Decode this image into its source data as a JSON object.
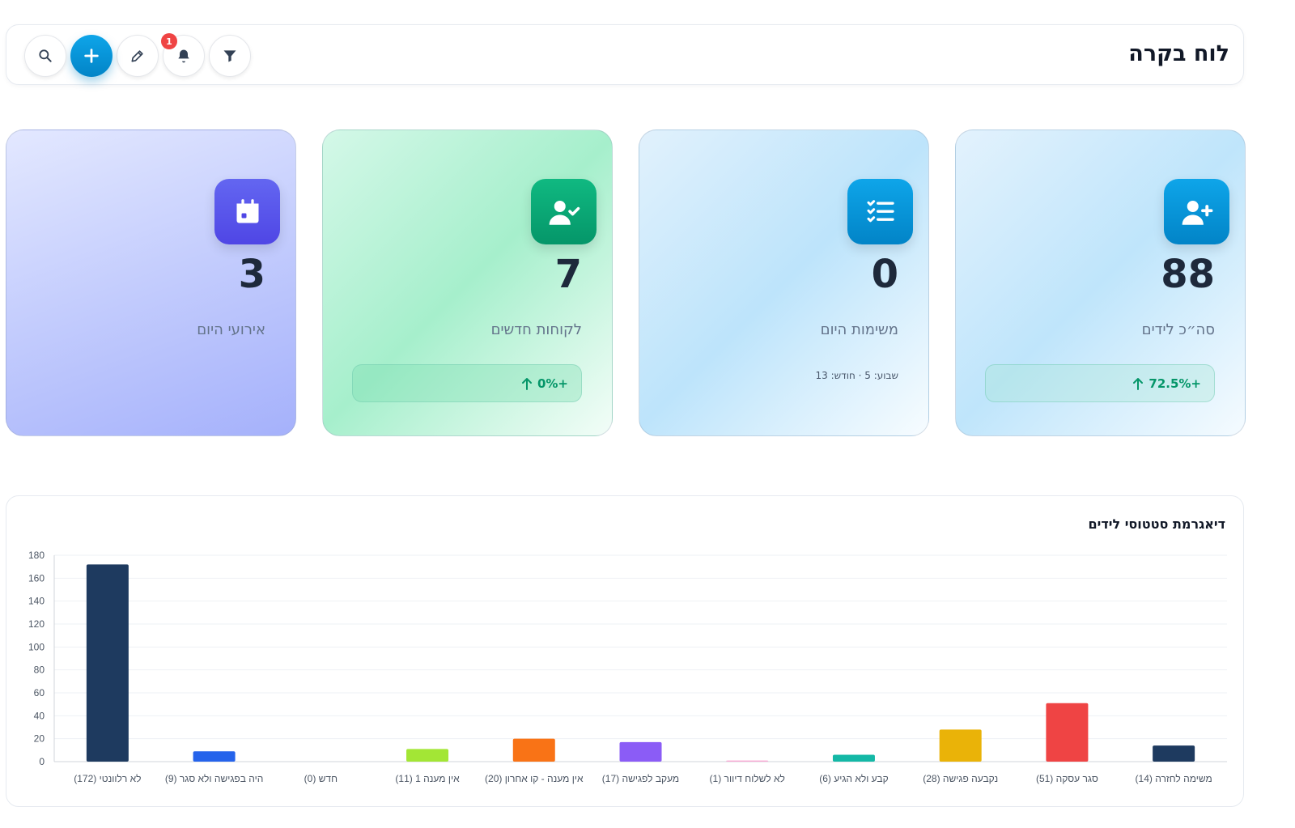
{
  "header": {
    "title": "לוח בקרה",
    "notification_count": "1",
    "buttons": [
      "filter-icon",
      "bell-icon",
      "pencil-icon",
      "plus-icon",
      "search-icon"
    ]
  },
  "cards": {
    "leads": {
      "value": "88",
      "label": "סה״כ לידים",
      "trend": "72.5%+",
      "icon": "user-plus-icon"
    },
    "tasks": {
      "value": "0",
      "label": "משימות היום",
      "sub": "שבוע: 5 · חודש: 13",
      "icon": "checklist-icon"
    },
    "customers": {
      "value": "7",
      "label": "לקוחות חדשים",
      "trend": "0%+",
      "icon": "user-check-icon"
    },
    "events": {
      "value": "3",
      "label": "אירועי היום",
      "icon": "calendar-icon"
    }
  },
  "colors": {
    "primary": "#0ea5e9",
    "success": "#059669",
    "indigo": "#4f46e5",
    "danger": "#ef4444"
  },
  "chart_data": {
    "type": "bar",
    "title": "דיאגרמת סטטוסי לידים",
    "ylim": [
      0,
      180
    ],
    "yticks": [
      0,
      20,
      40,
      60,
      80,
      100,
      120,
      140,
      160,
      180
    ],
    "categories": [
      "לא רלוונטי (172)",
      "היה בפגישה ולא סגר (9)",
      "חדש (0)",
      "אין מענה 1 (11)",
      "אין מענה - קו אחרון (20)",
      "מעקב לפגישה (17)",
      "לא לשלוח דיוור (1)",
      "קבע ולא הגיע (6)",
      "נקבעה פגישה (28)",
      "סגר עסקה (51)",
      "משימה לחזרה (14)"
    ],
    "values": [
      172,
      9,
      0,
      11,
      20,
      17,
      1,
      6,
      28,
      51,
      14
    ],
    "colors": [
      "#1e3a5f",
      "#2563eb",
      "#94a3b8",
      "#a3e635",
      "#f97316",
      "#8b5cf6",
      "#f9a8d4",
      "#14b8a6",
      "#eab308",
      "#ef4444",
      "#1e3a5f"
    ],
    "grid": true,
    "legend": "none"
  }
}
